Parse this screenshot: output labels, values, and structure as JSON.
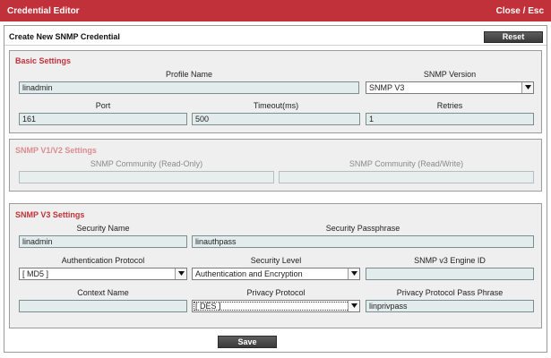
{
  "window": {
    "title": "Credential Editor",
    "close_label": "Close / Esc"
  },
  "header": {
    "title": "Create New SNMP Credential",
    "reset_label": "Reset"
  },
  "basic": {
    "title": "Basic Settings",
    "profile_name_label": "Profile Name",
    "profile_name_value": "linadmin",
    "snmp_version_label": "SNMP Version",
    "snmp_version_value": "SNMP V3",
    "port_label": "Port",
    "port_value": "161",
    "timeout_label": "Timeout(ms)",
    "timeout_value": "500",
    "retries_label": "Retries",
    "retries_value": "1"
  },
  "v1v2": {
    "title": "SNMP V1/V2 Settings",
    "community_ro_label": "SNMP Community (Read-Only)",
    "community_ro_value": "",
    "community_rw_label": "SNMP Community (Read/Write)",
    "community_rw_value": ""
  },
  "v3": {
    "title": "SNMP V3 Settings",
    "security_name_label": "Security Name",
    "security_name_value": "linadmin",
    "security_passphrase_label": "Security Passphrase",
    "security_passphrase_value": "linauthpass",
    "auth_protocol_label": "Authentication Protocol",
    "auth_protocol_value": "[ MD5 ]",
    "security_level_label": "Security Level",
    "security_level_value": "Authentication and Encryption",
    "engine_id_label": "SNMP v3 Engine ID",
    "engine_id_value": "",
    "context_name_label": "Context Name",
    "context_name_value": "",
    "privacy_protocol_label": "Privacy Protocol",
    "privacy_protocol_value": "[ DES ]",
    "privacy_pass_label": "Privacy Protocol Pass Phrase",
    "privacy_pass_value": "linprivpass"
  },
  "footer": {
    "save_label": "Save"
  },
  "colors": {
    "accent": "#c0313a",
    "disabled_accent": "#dc8c90",
    "field_bg": "#e3ecec",
    "button": "#444444"
  },
  "icons": {
    "dropdown": "chevron-down-icon"
  }
}
